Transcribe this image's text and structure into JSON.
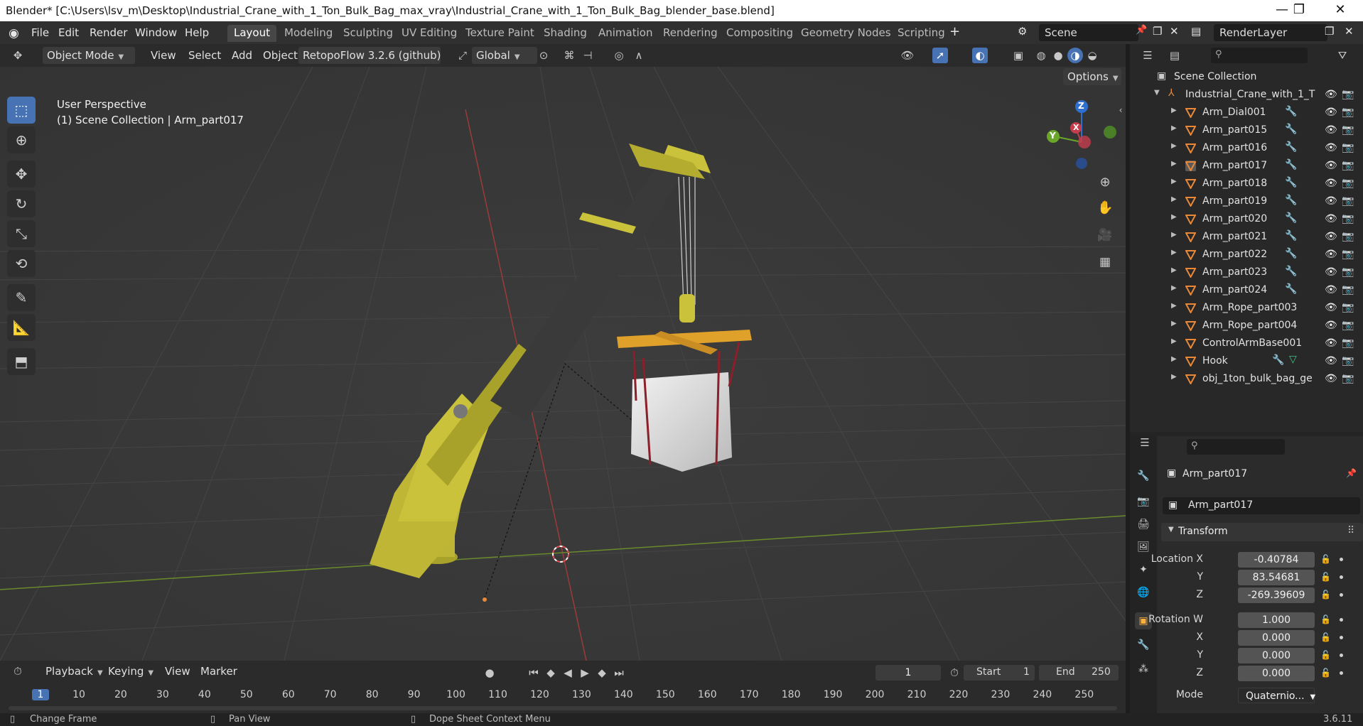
{
  "window": {
    "title": "Blender* [C:\\Users\\lsv_m\\Desktop\\Industrial_Crane_with_1_Ton_Bulk_Bag_max_vray\\Industrial_Crane_with_1_Ton_Bulk_Bag_blender_base.blend]",
    "minimize": "—",
    "maximize": "❐",
    "close": "✕"
  },
  "menu": {
    "file": "File",
    "edit": "Edit",
    "render": "Render",
    "window": "Window",
    "help": "Help"
  },
  "workspaces": [
    "Layout",
    "Modeling",
    "Sculpting",
    "UV Editing",
    "Texture Paint",
    "Shading",
    "Animation",
    "Rendering",
    "Compositing",
    "Geometry Nodes",
    "Scripting"
  ],
  "workspace_active": "Layout",
  "scene": {
    "name": "Scene",
    "render_layer": "RenderLayer"
  },
  "viewport_header": {
    "mode": "Object Mode",
    "view": "View",
    "select": "Select",
    "add": "Add",
    "object": "Object",
    "addon": "RetopoFlow 3.2.6 (github)",
    "orientation": "Global",
    "options": "Options"
  },
  "viewport": {
    "perspective": "User Perspective",
    "collection_info": "(1) Scene Collection | Arm_part017",
    "gizmo": {
      "z": "Z",
      "y": "Y",
      "x": "X"
    }
  },
  "outliner": {
    "root": "Scene Collection",
    "collection": "Industrial_Crane_with_1_T",
    "items": [
      {
        "name": "Arm_Dial001"
      },
      {
        "name": "Arm_part015"
      },
      {
        "name": "Arm_part016"
      },
      {
        "name": "Arm_part017"
      },
      {
        "name": "Arm_part018"
      },
      {
        "name": "Arm_part019"
      },
      {
        "name": "Arm_part020"
      },
      {
        "name": "Arm_part021"
      },
      {
        "name": "Arm_part022"
      },
      {
        "name": "Arm_part023"
      },
      {
        "name": "Arm_part024"
      },
      {
        "name": "Arm_Rope_part003"
      },
      {
        "name": "Arm_Rope_part004"
      },
      {
        "name": "ControlArmBase001"
      },
      {
        "name": "Hook"
      },
      {
        "name": "obj_1ton_bulk_bag_ge"
      }
    ]
  },
  "properties": {
    "object_name": "Arm_part017",
    "data_name": "Arm_part017",
    "panel": "Transform",
    "location": {
      "label": "Location X",
      "x": "-0.40784",
      "y_label": "Y",
      "y": "83.54681",
      "z_label": "Z",
      "z": "-269.39609"
    },
    "rotation": {
      "label": "Rotation W",
      "w": "1.000",
      "x_label": "X",
      "x": "0.000",
      "y_label": "Y",
      "y": "0.000",
      "z_label": "Z",
      "z": "0.000"
    },
    "mode_label": "Mode",
    "mode_value": "Quaternio..."
  },
  "timeline": {
    "playback": "Playback",
    "keying": "Keying",
    "view": "View",
    "marker": "Marker",
    "current_frame": "1",
    "start_label": "Start",
    "start": "1",
    "end_label": "End",
    "end": "250",
    "ticks": [
      "1",
      "10",
      "20",
      "30",
      "40",
      "50",
      "60",
      "70",
      "80",
      "90",
      "100",
      "110",
      "120",
      "130",
      "140",
      "150",
      "160",
      "170",
      "180",
      "190",
      "200",
      "210",
      "220",
      "230",
      "240",
      "250"
    ]
  },
  "statusbar": {
    "change_frame": "Change Frame",
    "pan_view": "Pan View",
    "context_menu": "Dope Sheet Context Menu",
    "version": "3.6.11"
  },
  "colors": {
    "accent": "#4772b3",
    "crane_yellow": "#c9c23a",
    "object_orange": "#e8893a"
  }
}
